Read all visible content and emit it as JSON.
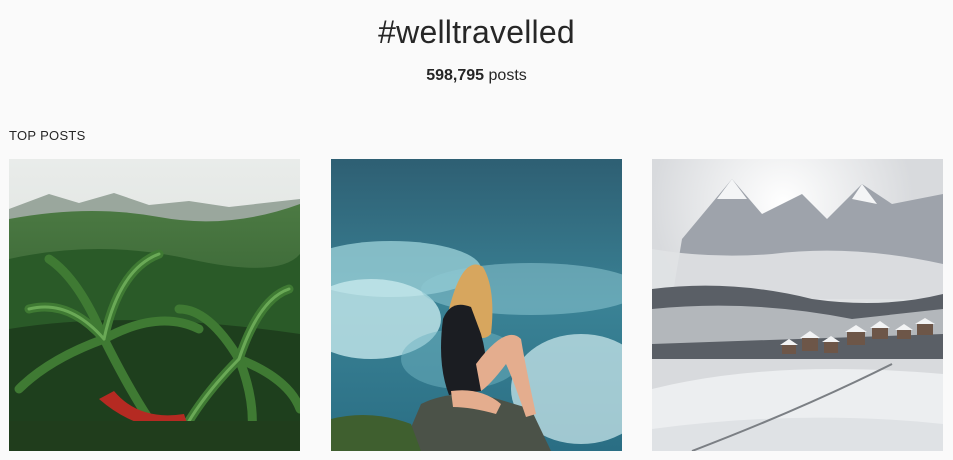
{
  "header": {
    "hashtag": "#welltravelled",
    "post_count_number": "598,795",
    "post_count_suffix": "posts"
  },
  "section": {
    "heading": "TOP POSTS"
  },
  "posts": [
    {
      "scene": "tropical-palms-photo"
    },
    {
      "scene": "woman-ocean-rock-photo"
    },
    {
      "scene": "snowy-mountain-village-photo"
    }
  ],
  "colors": {
    "background": "#fafafa",
    "text": "#262626"
  }
}
